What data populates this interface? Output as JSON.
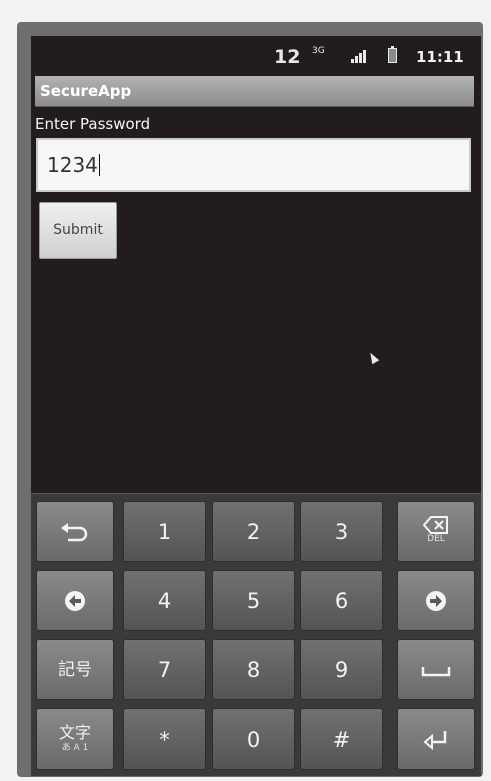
{
  "status_bar": {
    "notification_count": "12",
    "network_type": "3G",
    "time": "11:11"
  },
  "app": {
    "title": "SecureApp",
    "password_label": "Enter Password",
    "password_value": "1234",
    "submit_label": "Submit"
  },
  "keyboard": {
    "keys": {
      "k1": "1",
      "k2": "2",
      "k3": "3",
      "k4": "4",
      "k5": "5",
      "k6": "6",
      "k7": "7",
      "k8": "8",
      "k9": "9",
      "star": "*",
      "k0": "0",
      "hash": "#",
      "symbols": "記号",
      "input_mode": "文字",
      "input_mode_sub": "あ A 1",
      "delete_sub": "DEL"
    }
  }
}
